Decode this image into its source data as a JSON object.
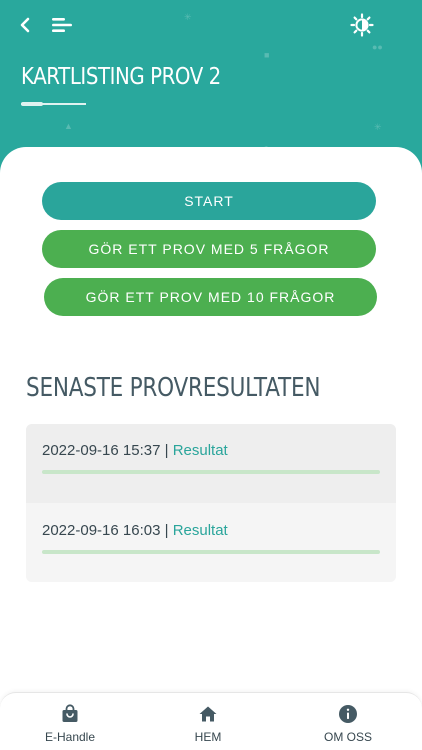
{
  "header": {
    "title": "KARTLISTING PROV 2",
    "background_color": "#29a89d",
    "icons": [
      "back-arrow-icon",
      "menu-icon",
      "theme-toggle-icon"
    ]
  },
  "actions": {
    "start_label": "START",
    "five_questions_label": "GÖR ETT PROV MED 5 FRÅGOR",
    "ten_questions_label": "GÖR ETT PROV MED 10 FRÅGOR",
    "start_color": "#2aa59b",
    "test_color": "#4caf50"
  },
  "results": {
    "heading": "SENASTE PROVRESULTATEN",
    "separator": "|",
    "items": [
      {
        "datetime": "2022-09-16 15:37",
        "link_label": "Resultat"
      },
      {
        "datetime": "2022-09-16 16:03",
        "link_label": "Resultat"
      }
    ]
  },
  "bottom_nav": {
    "items": [
      {
        "label": "E-Handle",
        "icon": "shopping-bag-icon"
      },
      {
        "label": "HEM",
        "icon": "home-icon"
      },
      {
        "label": "OM OSS",
        "icon": "info-icon"
      }
    ]
  }
}
